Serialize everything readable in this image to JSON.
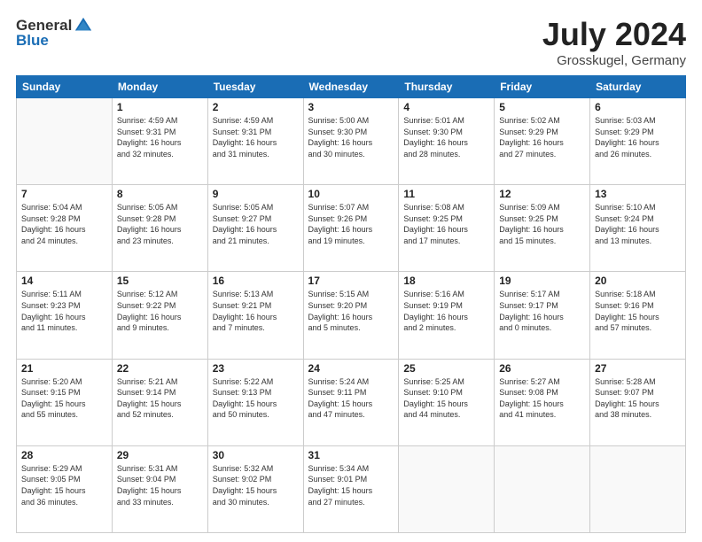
{
  "logo": {
    "general": "General",
    "blue": "Blue"
  },
  "header": {
    "title": "July 2024",
    "subtitle": "Grosskugel, Germany"
  },
  "days_of_week": [
    "Sunday",
    "Monday",
    "Tuesday",
    "Wednesday",
    "Thursday",
    "Friday",
    "Saturday"
  ],
  "weeks": [
    [
      {
        "num": "",
        "info": ""
      },
      {
        "num": "1",
        "info": "Sunrise: 4:59 AM\nSunset: 9:31 PM\nDaylight: 16 hours\nand 32 minutes."
      },
      {
        "num": "2",
        "info": "Sunrise: 4:59 AM\nSunset: 9:31 PM\nDaylight: 16 hours\nand 31 minutes."
      },
      {
        "num": "3",
        "info": "Sunrise: 5:00 AM\nSunset: 9:30 PM\nDaylight: 16 hours\nand 30 minutes."
      },
      {
        "num": "4",
        "info": "Sunrise: 5:01 AM\nSunset: 9:30 PM\nDaylight: 16 hours\nand 28 minutes."
      },
      {
        "num": "5",
        "info": "Sunrise: 5:02 AM\nSunset: 9:29 PM\nDaylight: 16 hours\nand 27 minutes."
      },
      {
        "num": "6",
        "info": "Sunrise: 5:03 AM\nSunset: 9:29 PM\nDaylight: 16 hours\nand 26 minutes."
      }
    ],
    [
      {
        "num": "7",
        "info": "Sunrise: 5:04 AM\nSunset: 9:28 PM\nDaylight: 16 hours\nand 24 minutes."
      },
      {
        "num": "8",
        "info": "Sunrise: 5:05 AM\nSunset: 9:28 PM\nDaylight: 16 hours\nand 23 minutes."
      },
      {
        "num": "9",
        "info": "Sunrise: 5:05 AM\nSunset: 9:27 PM\nDaylight: 16 hours\nand 21 minutes."
      },
      {
        "num": "10",
        "info": "Sunrise: 5:07 AM\nSunset: 9:26 PM\nDaylight: 16 hours\nand 19 minutes."
      },
      {
        "num": "11",
        "info": "Sunrise: 5:08 AM\nSunset: 9:25 PM\nDaylight: 16 hours\nand 17 minutes."
      },
      {
        "num": "12",
        "info": "Sunrise: 5:09 AM\nSunset: 9:25 PM\nDaylight: 16 hours\nand 15 minutes."
      },
      {
        "num": "13",
        "info": "Sunrise: 5:10 AM\nSunset: 9:24 PM\nDaylight: 16 hours\nand 13 minutes."
      }
    ],
    [
      {
        "num": "14",
        "info": "Sunrise: 5:11 AM\nSunset: 9:23 PM\nDaylight: 16 hours\nand 11 minutes."
      },
      {
        "num": "15",
        "info": "Sunrise: 5:12 AM\nSunset: 9:22 PM\nDaylight: 16 hours\nand 9 minutes."
      },
      {
        "num": "16",
        "info": "Sunrise: 5:13 AM\nSunset: 9:21 PM\nDaylight: 16 hours\nand 7 minutes."
      },
      {
        "num": "17",
        "info": "Sunrise: 5:15 AM\nSunset: 9:20 PM\nDaylight: 16 hours\nand 5 minutes."
      },
      {
        "num": "18",
        "info": "Sunrise: 5:16 AM\nSunset: 9:19 PM\nDaylight: 16 hours\nand 2 minutes."
      },
      {
        "num": "19",
        "info": "Sunrise: 5:17 AM\nSunset: 9:17 PM\nDaylight: 16 hours\nand 0 minutes."
      },
      {
        "num": "20",
        "info": "Sunrise: 5:18 AM\nSunset: 9:16 PM\nDaylight: 15 hours\nand 57 minutes."
      }
    ],
    [
      {
        "num": "21",
        "info": "Sunrise: 5:20 AM\nSunset: 9:15 PM\nDaylight: 15 hours\nand 55 minutes."
      },
      {
        "num": "22",
        "info": "Sunrise: 5:21 AM\nSunset: 9:14 PM\nDaylight: 15 hours\nand 52 minutes."
      },
      {
        "num": "23",
        "info": "Sunrise: 5:22 AM\nSunset: 9:13 PM\nDaylight: 15 hours\nand 50 minutes."
      },
      {
        "num": "24",
        "info": "Sunrise: 5:24 AM\nSunset: 9:11 PM\nDaylight: 15 hours\nand 47 minutes."
      },
      {
        "num": "25",
        "info": "Sunrise: 5:25 AM\nSunset: 9:10 PM\nDaylight: 15 hours\nand 44 minutes."
      },
      {
        "num": "26",
        "info": "Sunrise: 5:27 AM\nSunset: 9:08 PM\nDaylight: 15 hours\nand 41 minutes."
      },
      {
        "num": "27",
        "info": "Sunrise: 5:28 AM\nSunset: 9:07 PM\nDaylight: 15 hours\nand 38 minutes."
      }
    ],
    [
      {
        "num": "28",
        "info": "Sunrise: 5:29 AM\nSunset: 9:05 PM\nDaylight: 15 hours\nand 36 minutes."
      },
      {
        "num": "29",
        "info": "Sunrise: 5:31 AM\nSunset: 9:04 PM\nDaylight: 15 hours\nand 33 minutes."
      },
      {
        "num": "30",
        "info": "Sunrise: 5:32 AM\nSunset: 9:02 PM\nDaylight: 15 hours\nand 30 minutes."
      },
      {
        "num": "31",
        "info": "Sunrise: 5:34 AM\nSunset: 9:01 PM\nDaylight: 15 hours\nand 27 minutes."
      },
      {
        "num": "",
        "info": ""
      },
      {
        "num": "",
        "info": ""
      },
      {
        "num": "",
        "info": ""
      }
    ]
  ]
}
